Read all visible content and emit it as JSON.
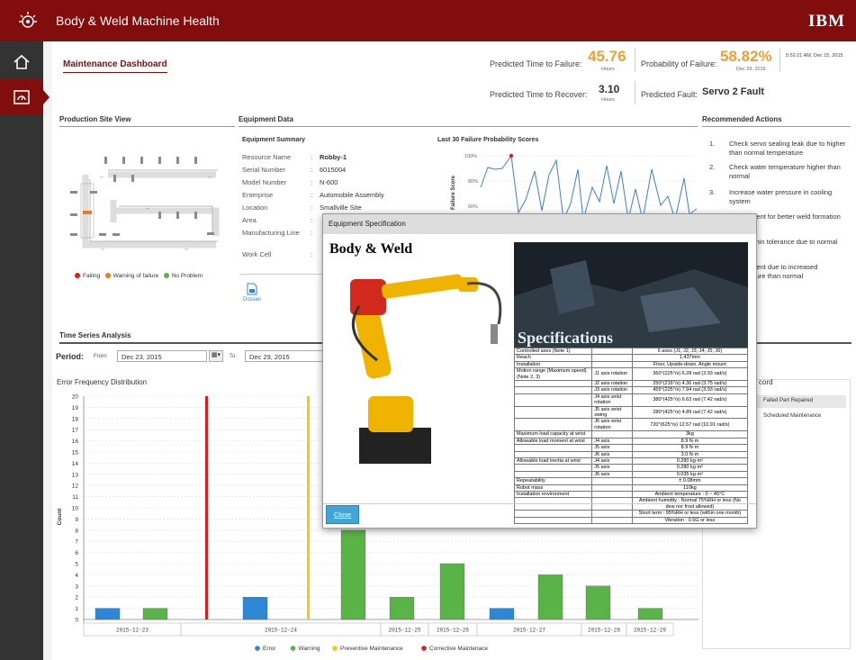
{
  "app": {
    "title": "Body & Weld Machine Health",
    "brand": "IBM"
  },
  "dashboard": {
    "title": "Maintenance Dashboard"
  },
  "kpis": {
    "ttf_label": "Predicted Time to Failure:",
    "ttf_value": "45.76",
    "ttf_unit": "Hours",
    "pof_label": "Probability of Failure:",
    "pof_value": "58.82%",
    "pof_date": "Dec 29, 2015",
    "timestamp": "5:52:21 AM, Dec 15, 2015",
    "ttr_label": "Predicted Time to Recover:",
    "ttr_value": "3.10",
    "ttr_unit": "Hours",
    "fault_label": "Predicted Fault:",
    "fault_value": "Servo 2 Fault"
  },
  "sections": {
    "site": "Production Site View",
    "equipment": "Equipment Data",
    "actions": "Recommended Actions",
    "timeseries": "Time Series Analysis",
    "equipment_summary": "Equipment Summary",
    "failure_scores": "Last 30 Failure Probability Scores",
    "failure_score_axis": "Failure Score",
    "error_freq": "Error Frequency Distribution",
    "record_suffix": "cord"
  },
  "site_legend": {
    "failing": "Failing",
    "warning": "Warning of failure",
    "ok": "No Problem"
  },
  "summary": [
    {
      "label": "Resource Name",
      "value": "Robby-1"
    },
    {
      "label": "Serial Number",
      "value": "6015004"
    },
    {
      "label": "Model Number",
      "value": "N-600"
    },
    {
      "label": "Enterprise",
      "value": "Automobile Assembly"
    },
    {
      "label": "Location",
      "value": "Smallville Site"
    },
    {
      "label": "Area",
      "value": ""
    },
    {
      "label": "Manufacturing Line",
      "value": ""
    },
    {
      "label": "Work Cell",
      "value": ""
    }
  ],
  "dossier": "Dossier",
  "actions": [
    {
      "num": "1.",
      "text": "Check servo sealing leak due to higher than normal temperature"
    },
    {
      "num": "2.",
      "text": "Check water temperature higher than normal"
    },
    {
      "num": "3.",
      "text": "Increase water pressure in cooling system"
    },
    {
      "num": "",
      "text": "weld current for better weld formation"
    },
    {
      "num": "",
      "text": "servo within tolerance due to normal range"
    },
    {
      "num": "",
      "text": "weld current due to increased temperature than normal"
    }
  ],
  "period": {
    "label": "Period:",
    "from_label": "From:",
    "from_value": "Dec 23, 2015",
    "to_label": "To:",
    "to_value": "Dec 29, 2015"
  },
  "records": [
    "Failed Part Repaired",
    "Scheduled Maintenance"
  ],
  "chart_data": [
    {
      "type": "bar",
      "title": "Error Frequency Distribution",
      "ylabel": "Count",
      "ylim": [
        0,
        20
      ],
      "categories": [
        "2015-12-23",
        "2015-12-24",
        "2015-12-25",
        "2015-12-26",
        "2015-12-27",
        "2015-12-28",
        "2015-12-29"
      ],
      "series": [
        {
          "name": "Error",
          "color": "#2d86d6"
        },
        {
          "name": "Warning",
          "color": "#5ab347"
        },
        {
          "name": "Preventive Maintenance",
          "color": "#f2c811"
        },
        {
          "name": "Corrective Maintenace",
          "color": "#e01d1d"
        }
      ]
    },
    {
      "type": "line",
      "title": "Last 30 Failure Probability Scores",
      "ylabel": "Failure Score",
      "yticks": [
        "100%",
        "80%",
        "60%"
      ]
    }
  ],
  "modal": {
    "title": "Equipment Specification",
    "heading": "Body & Weld",
    "banner": "Specifications",
    "close": "Close"
  },
  "spec_rows": [
    [
      "Controlled axes (Note 1)",
      "",
      "6 axes (J1, J2, J3, J4, J5, J6)"
    ],
    [
      "Reach",
      "",
      "1,437mm"
    ],
    [
      "Installation",
      "",
      "Floor, Upside-down, Angle mount"
    ],
    [
      "Motion range (Maximum speed) (Note 2, 3)",
      "J1 axis rotation",
      "360°(225°/s) 6.28 rad (3.93 rad/s)"
    ],
    [
      "",
      "J2 axis rotation",
      "250°(216°/s) 4.36 rad (3.75 rad/s)"
    ],
    [
      "",
      "J3 axis rotation",
      "455°(225°/s) 7.94 rad (3.93 rad/s)"
    ],
    [
      "",
      "J4 axis wrist rotation",
      "380°(425°/s) 6.63 rad (7.42 rad/s)"
    ],
    [
      "",
      "J5 axis wrist swing",
      "280°(425°/s) 4.89 rad (7.42 rad/s)"
    ],
    [
      "",
      "J6 axis wrist rotation",
      "720°(625°/s) 12.57 rad (10.91 rad/s)"
    ],
    [
      "Maximum load capacity at wrist",
      "",
      "3kg"
    ],
    [
      "Allowable load moment at wrist",
      "J4 axis",
      "8.9 N·m"
    ],
    [
      "",
      "J5 axis",
      "8.9 N·m"
    ],
    [
      "",
      "J6 axis",
      "3.0 N·m"
    ],
    [
      "Allowable load inertia at wrist",
      "J4 axis",
      "0.280 kg·m²"
    ],
    [
      "",
      "J5 axis",
      "0.280 kg·m²"
    ],
    [
      "",
      "J6 axis",
      "0.035 kg·m²"
    ],
    [
      "Repeatability",
      "",
      "± 0.08mm"
    ],
    [
      "Robot mass",
      "",
      "110kg"
    ],
    [
      "Installation environment",
      "",
      "Ambient temperature : 0 ~ 45°C"
    ],
    [
      "",
      "",
      "Ambient humidity : Normal 75%RH or less (No dew nor frost allowed)"
    ],
    [
      "",
      "",
      "Short term : 95%RH or less (within one month)"
    ],
    [
      "",
      "",
      "Vibration : 0.5G or less"
    ]
  ]
}
